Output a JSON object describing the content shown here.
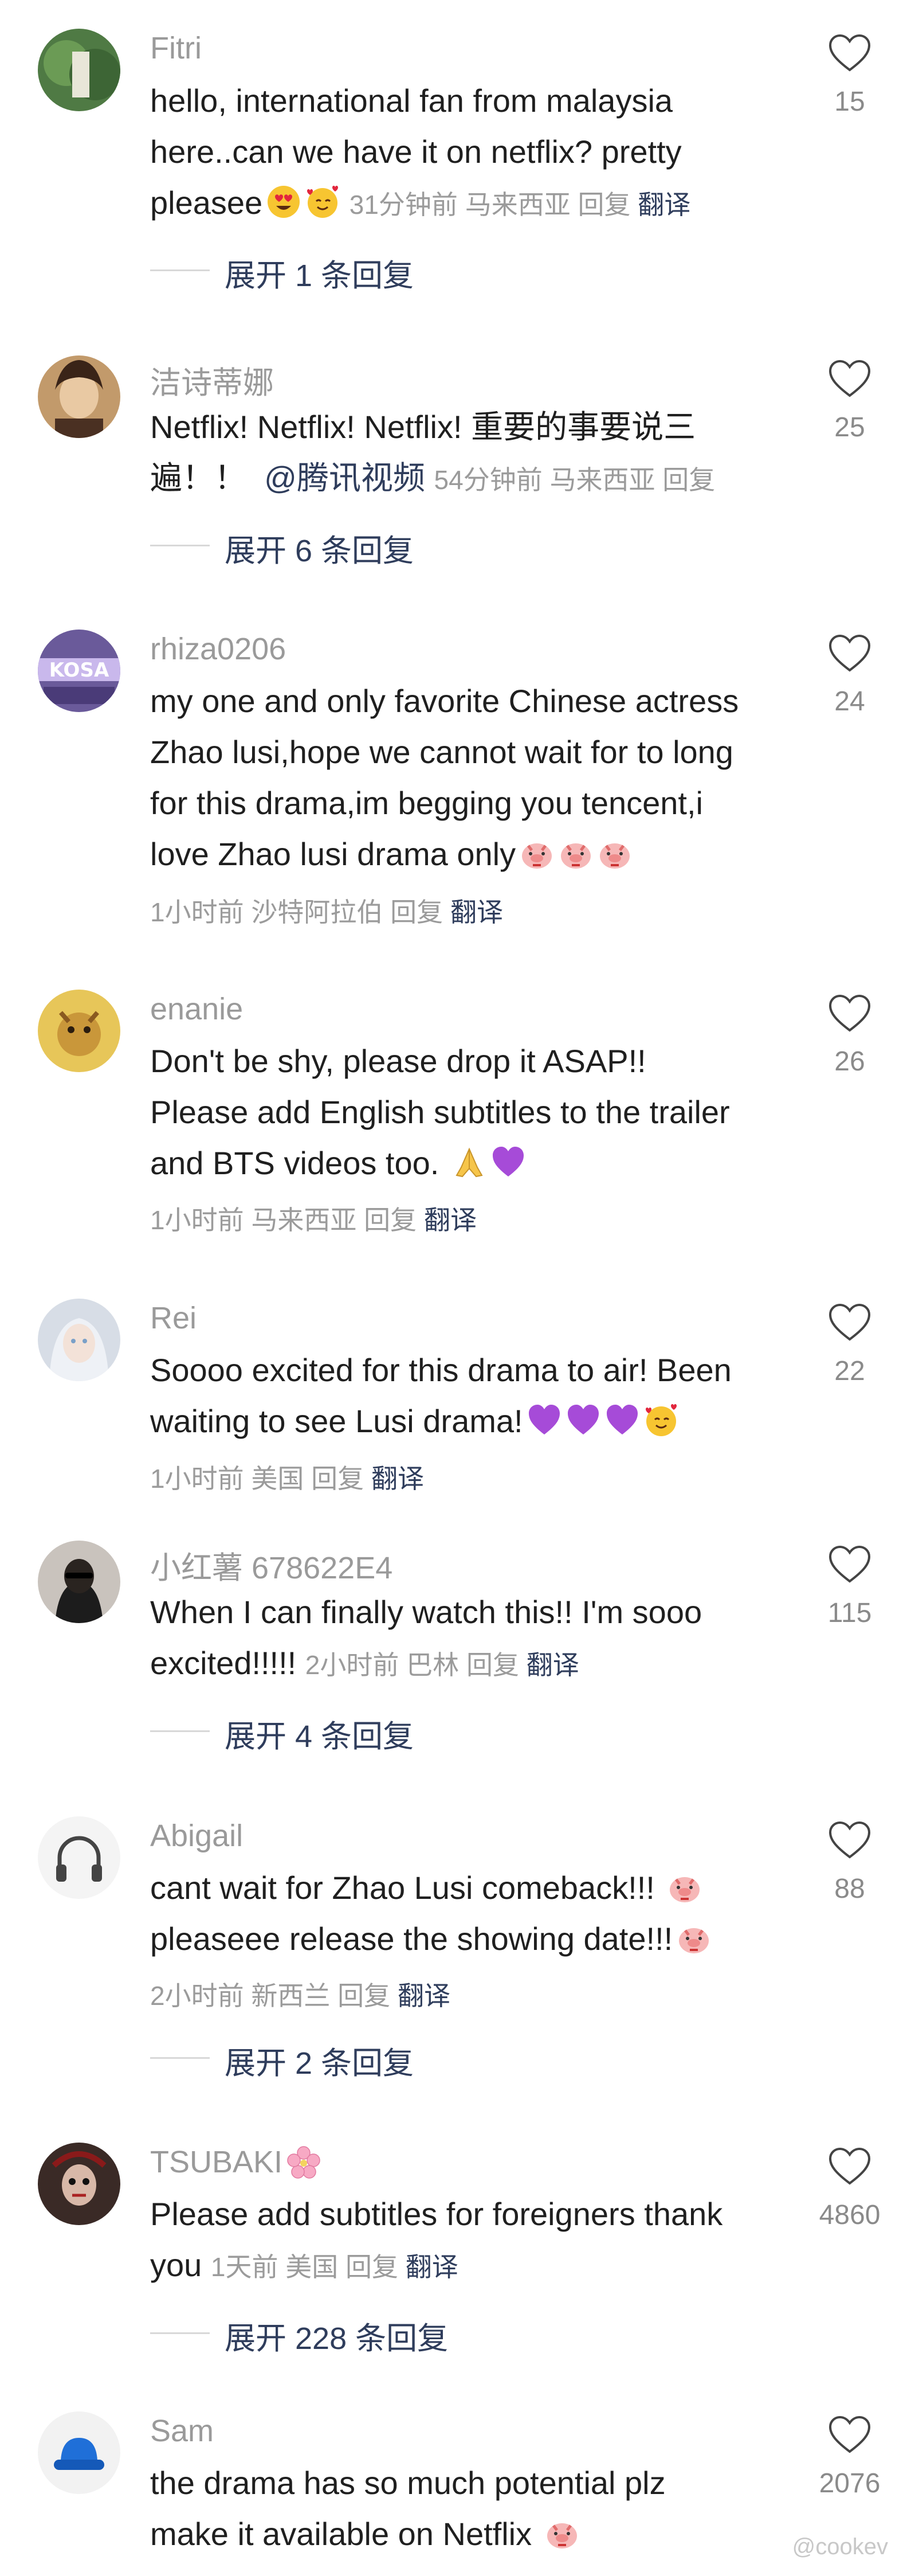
{
  "comments": [
    {
      "username": "Fitri",
      "lines": [
        "hello, international fan from malaysia",
        "here..can we have it on netflix? pretty",
        "pleasee"
      ],
      "time": "31分钟前",
      "location": "马来西亚",
      "reply": "回复",
      "translate": "翻译",
      "likes": "15",
      "expand": "展开 1 条回复"
    },
    {
      "username": "洁诗蒂娜",
      "lines": [
        "Netflix! Netflix! Netflix! 重要的事要说三",
        "遍！！"
      ],
      "mention": "@腾讯视频",
      "time": "54分钟前",
      "location": "马来西亚",
      "reply": "回复",
      "likes": "25",
      "expand": "展开 6 条回复"
    },
    {
      "username": "rhiza0206",
      "lines": [
        "my one and only favorite Chinese actress",
        "Zhao lusi,hope we cannot wait for to long",
        "for this drama,im begging you tencent,i",
        "love Zhao lusi drama only"
      ],
      "time": "1小时前",
      "location": "沙特阿拉伯",
      "reply": "回复",
      "translate": "翻译",
      "likes": "24"
    },
    {
      "username": "enanie",
      "lines": [
        "Don't be shy, please drop it ASAP!!",
        "Please add English subtitles to the trailer",
        "and BTS videos too."
      ],
      "time": "1小时前",
      "location": "马来西亚",
      "reply": "回复",
      "translate": "翻译",
      "likes": "26"
    },
    {
      "username": "Rei",
      "lines": [
        "Soooo excited for this drama to air! Been",
        "waiting to see Lusi drama!"
      ],
      "time": "1小时前",
      "location": "美国",
      "reply": "回复",
      "translate": "翻译",
      "likes": "22"
    },
    {
      "username": "小红薯 678622E4",
      "lines": [
        "When I can finally watch this!! I'm sooo",
        "excited!!!!!"
      ],
      "time": "2小时前",
      "location": "巴林",
      "reply": "回复",
      "translate": "翻译",
      "likes": "115",
      "expand": "展开 4 条回复"
    },
    {
      "username": "Abigail",
      "lines": [
        "cant wait for Zhao Lusi comeback!!!",
        "pleaseee release the showing date!!!"
      ],
      "time": "2小时前",
      "location": "新西兰",
      "reply": "回复",
      "translate": "翻译",
      "likes": "88",
      "expand": "展开 2 条回复"
    },
    {
      "username": "TSUBAKI",
      "lines": [
        "Please add subtitles for foreigners thank",
        "you"
      ],
      "time": "1天前",
      "location": "美国",
      "reply": "回复",
      "translate": "翻译",
      "likes": "4860",
      "expand": "展开 228 条回复"
    },
    {
      "username": "Sam",
      "lines": [
        "the drama has so much potential plz",
        "make it available on Netflix"
      ],
      "likes": "2076"
    }
  ],
  "watermark": "@cookev",
  "icons": {
    "like": "heart-outline-icon"
  }
}
